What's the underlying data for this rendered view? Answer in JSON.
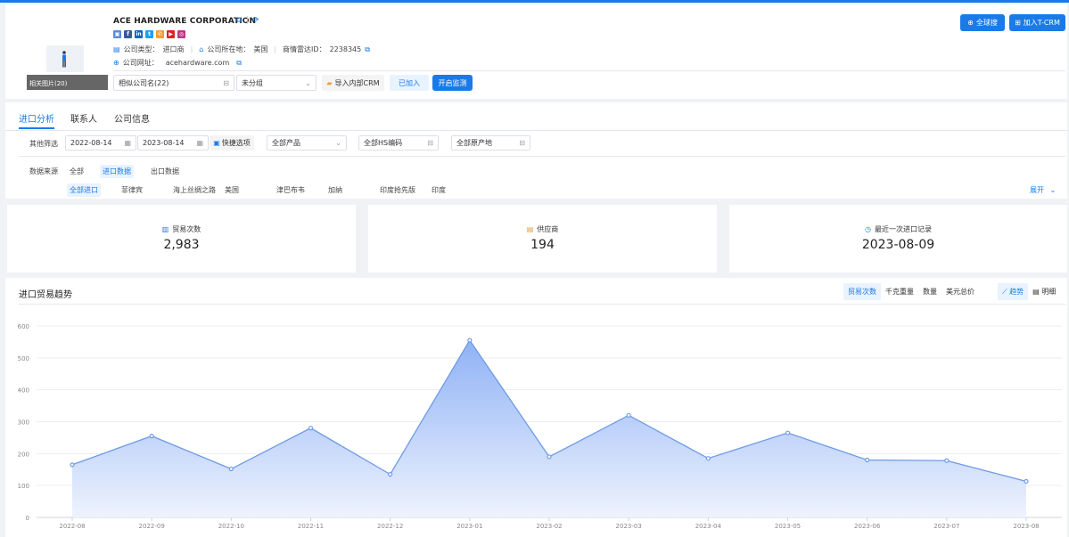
{
  "company": {
    "name": "ACE HARDWARE CORPORATION",
    "photo_label": "相关图片(20)",
    "type_label": "公司类型：",
    "type_value": "进口商",
    "country_label": "公司所在地：",
    "country_value": "美国",
    "radar_id_label": "商情雷达ID：",
    "radar_id_value": "2238345",
    "website_label": "公司网址：",
    "website_value": "acehardware.com",
    "social_icons": [
      "web-icon",
      "facebook-icon",
      "linkedin-icon",
      "twitter-icon",
      "phone-icon",
      "youtube-icon",
      "instagram-icon"
    ]
  },
  "actions": {
    "similar_companies": "相似公司名(22)",
    "group_select": "未分组",
    "import_crm": "导入内部CRM",
    "joined": "已加入",
    "start_monitor": "开启监测",
    "global_search": "全球搜",
    "join_tcrm": "加入T-CRM"
  },
  "tabs": [
    "进口分析",
    "联系人",
    "公司信息"
  ],
  "filters": {
    "label": "其他筛选",
    "date_start": "2022-08-14",
    "date_end": "2023-08-14",
    "quick_options": "快捷选项",
    "product": "全部产品",
    "hs_code": "全部HS编码",
    "origin": "全部原产地"
  },
  "data_source": {
    "label": "数据来源",
    "options": [
      "全部",
      "进口数据",
      "出口数据"
    ],
    "countries": [
      "全部进口",
      "菲律宾",
      "海上丝绸之路",
      "美国",
      "津巴布韦",
      "加纳",
      "印度抢先版",
      "印度"
    ],
    "expand": "展开"
  },
  "stats": [
    {
      "label": "贸易次数",
      "value": "2,983",
      "icon": "bar-chart-icon"
    },
    {
      "label": "供应商",
      "value": "194",
      "icon": "supplier-icon"
    },
    {
      "label": "最近一次进口记录",
      "value": "2023-08-09",
      "icon": "clock-icon"
    }
  ],
  "chart_header": {
    "title": "进口贸易趋势",
    "metrics": [
      "贸易次数",
      "千克重量",
      "数量",
      "美元总价"
    ],
    "views": [
      "趋势",
      "明细"
    ]
  },
  "colors": {
    "primary": "#1a7be8",
    "line": "#6f9be6",
    "area_top": "#8fb2f6",
    "area_bottom": "#eef3fd"
  },
  "chart_data": {
    "type": "area",
    "categories": [
      "2022-08",
      "2022-09",
      "2022-10",
      "2022-11",
      "2022-12",
      "2023-01",
      "2023-02",
      "2023-03",
      "2023-04",
      "2023-05",
      "2023-06",
      "2023-07",
      "2023-08"
    ],
    "values": [
      165,
      255,
      152,
      280,
      135,
      555,
      190,
      320,
      185,
      265,
      180,
      178,
      113
    ],
    "ylim": [
      0,
      600
    ],
    "yticks": [
      0,
      100,
      200,
      300,
      400,
      500,
      600
    ],
    "grid": true,
    "legend": "none"
  }
}
